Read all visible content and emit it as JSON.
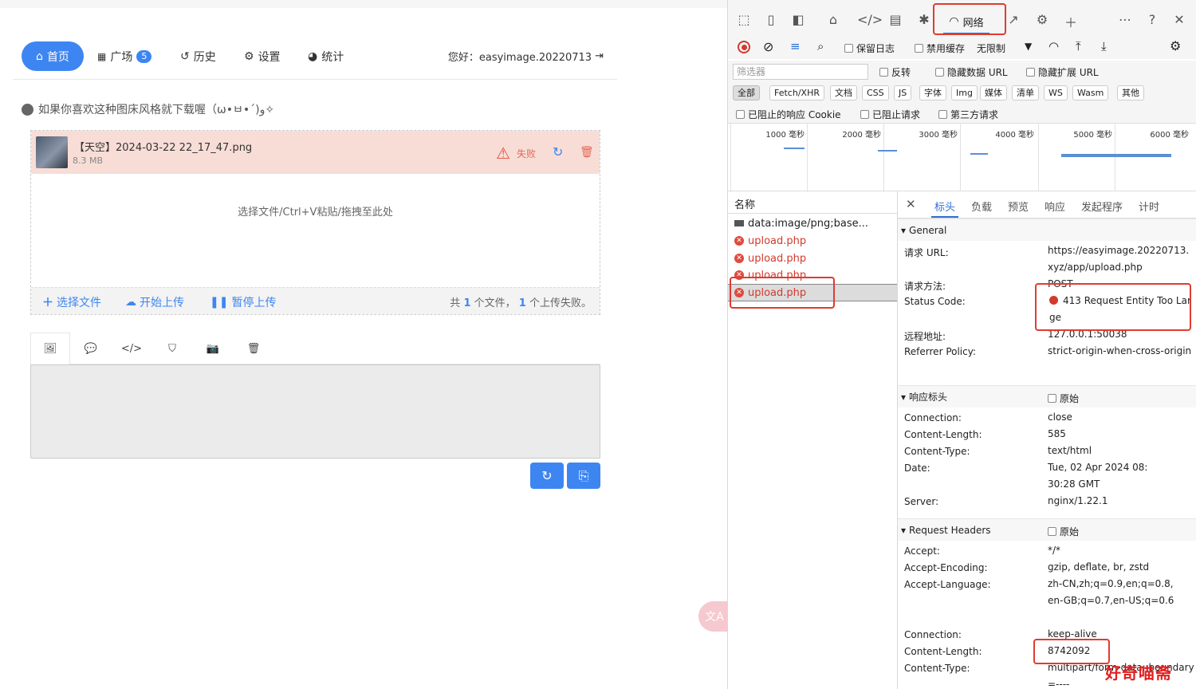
{
  "nav": {
    "home": "首页",
    "plaza": "广场",
    "plaza_count": "5",
    "history": "历史",
    "settings": "设置",
    "stats": "统计",
    "greeting": "您好：easyimage.20220713"
  },
  "tip": "如果你喜欢这种图床风格就下载喔（ω•ㅂ•´)و✧",
  "upload": {
    "file_name": "【天空】2024-03-22 22_17_47.png",
    "file_size": "8.3 MB",
    "status": "失败",
    "drop_hint": "选择文件/Ctrl+V粘贴/拖拽至此处",
    "choose": "选择文件",
    "start": "开始上传",
    "pause": "暂停上传",
    "summary_prefix": "共",
    "summary_total": "1",
    "summary_mid": "个文件，",
    "summary_failed": "1",
    "summary_suffix": "个上传失败。"
  },
  "translate_icon": "文A",
  "devtools": {
    "network_tab": "网络",
    "preserve_log": "保留日志",
    "disable_cache": "禁用缓存",
    "throttle": "无限制",
    "filter_placeholder": "筛选器",
    "invert": "反转",
    "hide_data_url": "隐藏数据 URL",
    "hide_ext_url": "隐藏扩展 URL",
    "types": [
      "全部",
      "Fetch/XHR",
      "文档",
      "CSS",
      "JS",
      "字体",
      "Img",
      "媒体",
      "清单",
      "WS",
      "Wasm",
      "其他"
    ],
    "blocked_cookies": "已阻止的响应 Cookie",
    "blocked_requests": "已阻止请求",
    "third_party": "第三方请求",
    "timeline_ticks": [
      "1000  毫秒",
      "2000  毫秒",
      "3000  毫秒",
      "4000  毫秒",
      "5000  毫秒",
      "6000  毫秒"
    ],
    "name_header": "名称",
    "requests": [
      {
        "name": "data:image/png;base..."
      },
      {
        "name": "upload.php"
      },
      {
        "name": "upload.php"
      },
      {
        "name": "upload.php"
      },
      {
        "name": "upload.php"
      }
    ],
    "detail_tabs": [
      "标头",
      "负载",
      "预览",
      "响应",
      "发起程序",
      "计时"
    ],
    "general": {
      "title": "General",
      "url_label": "请求 URL:",
      "url": "https://easyimage.20220713.xyz/app/upload.php",
      "method_label": "请求方法:",
      "method": "POST",
      "status_label": "Status Code:",
      "status": "413 Request Entity Too Large",
      "remote_label": "远程地址:",
      "remote": "127.0.0.1:50038",
      "referrer_label": "Referrer Policy:",
      "referrer": "strict-origin-when-cross-origin"
    },
    "response_headers": {
      "title": "响应标头",
      "raw": "原始",
      "items": [
        {
          "k": "Connection:",
          "v": "close"
        },
        {
          "k": "Content-Length:",
          "v": "585"
        },
        {
          "k": "Content-Type:",
          "v": "text/html"
        },
        {
          "k": "Date:",
          "v": "Tue, 02 Apr 2024 08:30:28 GMT"
        },
        {
          "k": "Server:",
          "v": "nginx/1.22.1"
        }
      ]
    },
    "request_headers": {
      "title": "Request Headers",
      "raw": "原始",
      "items": [
        {
          "k": "Accept:",
          "v": "*/*"
        },
        {
          "k": "Accept-Encoding:",
          "v": "gzip, deflate, br, zstd"
        },
        {
          "k": "Accept-Language:",
          "v": "zh-CN,zh;q=0.9,en;q=0.8,en-GB;q=0.7,en-US;q=0.6"
        },
        {
          "k": "Connection:",
          "v": "keep-alive"
        },
        {
          "k": "Content-Length:",
          "v": "8742092"
        },
        {
          "k": "Content-Type:",
          "v": "multipart/form-data; boundary=----"
        }
      ]
    }
  },
  "watermark": "好奇喵斋"
}
